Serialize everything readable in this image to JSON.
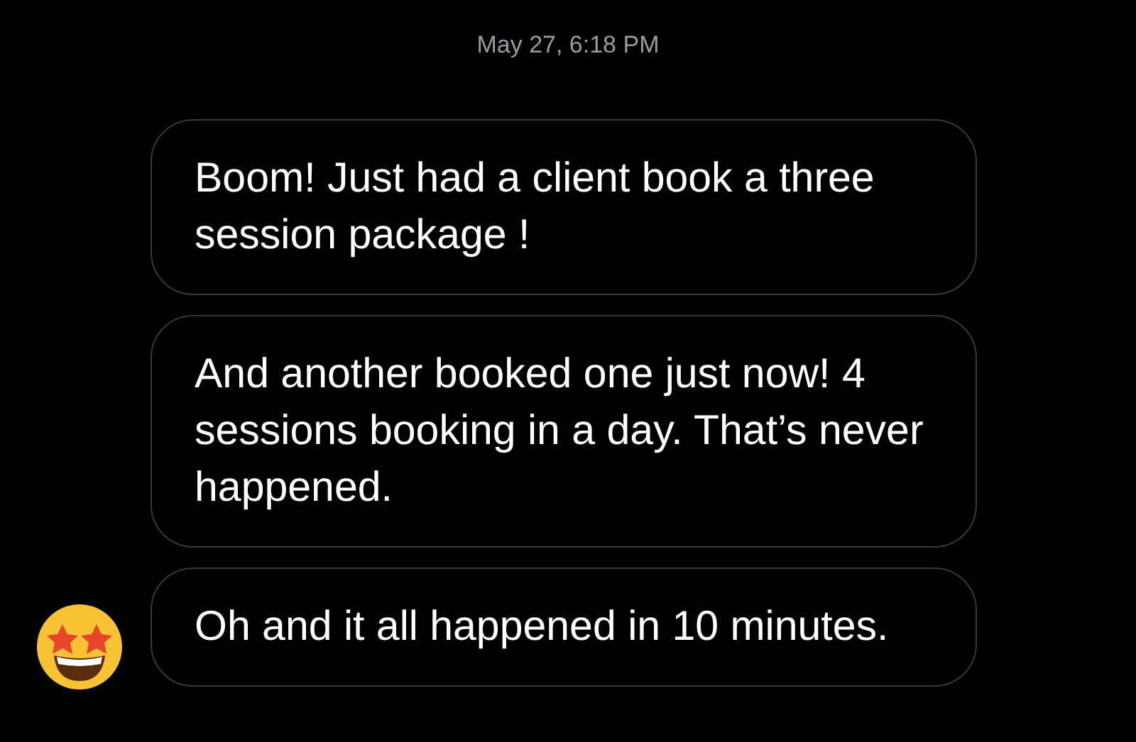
{
  "timestamp": "May 27, 6:18 PM",
  "messages": [
    {
      "text": "Boom! Just had a client book a three session package !",
      "show_avatar": false
    },
    {
      "text": "And another booked one just now! 4 sessions booking in a day. That’s never happened.",
      "show_avatar": false
    },
    {
      "text": "Oh and it all happened in 10 minutes.",
      "show_avatar": true
    }
  ]
}
